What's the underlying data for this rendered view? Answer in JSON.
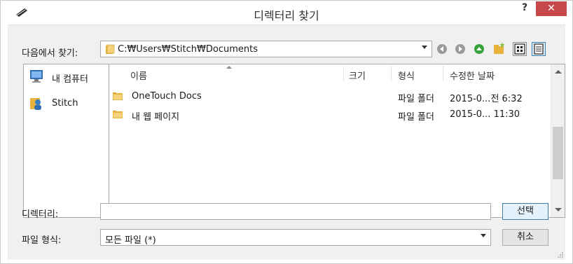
{
  "window": {
    "title": "디렉터리 찾기",
    "help_label": "?",
    "close_label": "✕"
  },
  "lookin": {
    "label": "다음에서 찾기:",
    "path": "C:₩Users₩Stitch₩Documents"
  },
  "places": [
    {
      "label": "내 컴퓨터",
      "icon": "computer-icon"
    },
    {
      "label": "Stitch",
      "icon": "user-folder-icon"
    }
  ],
  "columns": {
    "name": "이름",
    "size": "크기",
    "type": "형식",
    "date": "수정한 날짜"
  },
  "files": [
    {
      "name": "OneTouch Docs",
      "size": "",
      "type": "파일 폴더",
      "date": "2015-0...전 6:32"
    },
    {
      "name": "내 웹 페이지",
      "size": "",
      "type": "파일 폴더",
      "date": "2015-0... 11:30"
    }
  ],
  "directory": {
    "label": "디렉터리:",
    "value": "",
    "select_button": "선택"
  },
  "filetype": {
    "label": "파일 형식:",
    "value": "모든 파일 (*)",
    "cancel_button": "취소"
  },
  "colors": {
    "close_bg": "#c7484a",
    "folder": "#e8b33c",
    "nav_green": "#3aa23a",
    "nav_gray": "#9a9a9a"
  }
}
